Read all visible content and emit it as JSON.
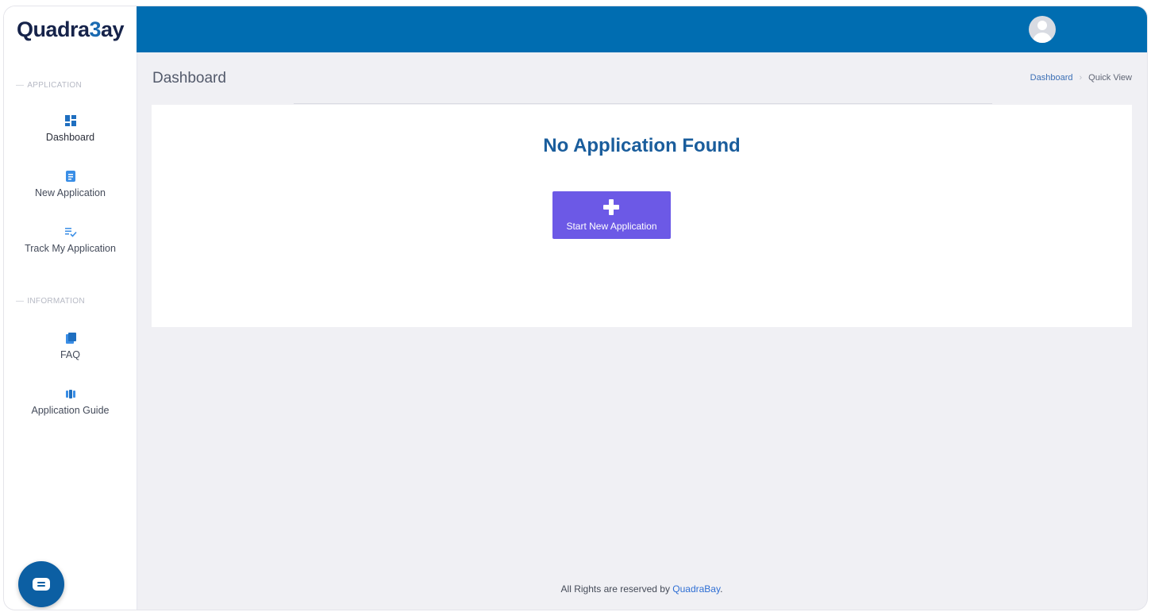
{
  "brand": {
    "logo_pre": "Quadra",
    "logo_b": "3",
    "logo_post": "ay"
  },
  "header": {
    "user_name": ""
  },
  "sidebar": {
    "sections": [
      {
        "label": "APPLICATION"
      },
      {
        "label": "INFORMATION"
      }
    ],
    "items": [
      {
        "label": "Dashboard",
        "icon": "dashboard-icon"
      },
      {
        "label": "New Application",
        "icon": "document-icon"
      },
      {
        "label": "Track My Application",
        "icon": "list-check-icon"
      },
      {
        "label": "FAQ",
        "icon": "book-icon"
      },
      {
        "label": "Application Guide",
        "icon": "guide-icon"
      }
    ]
  },
  "page": {
    "title": "Dashboard",
    "breadcrumb": [
      "Dashboard",
      "Quick View"
    ]
  },
  "card": {
    "title": "No Application Found",
    "button_label": "Start New Application"
  },
  "footer": {
    "text": "All Rights are reserved by ",
    "brand": "QuadraBay",
    "suffix": "."
  },
  "colors": {
    "topbar": "#006db1",
    "button": "#6c59e6",
    "title": "#1a5d9c",
    "chat": "#0c5fa3"
  }
}
